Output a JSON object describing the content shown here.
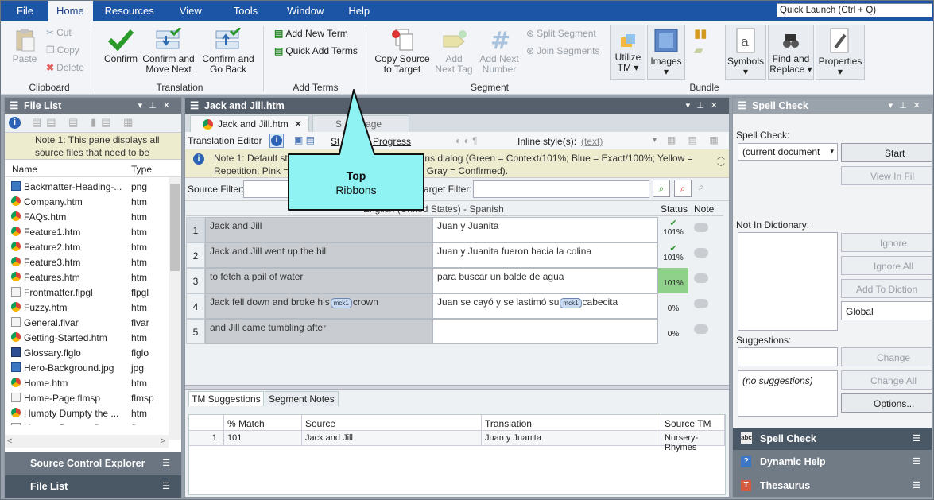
{
  "menu": {
    "file": "File",
    "home": "Home",
    "resources": "Resources",
    "view": "View",
    "tools": "Tools",
    "window": "Window",
    "help": "Help",
    "quick_launch": "Quick Launch (Ctrl + Q)"
  },
  "ribbon": {
    "clipboard": {
      "paste": "Paste",
      "cut": "Cut",
      "copy": "Copy",
      "delete": "Delete",
      "group": "Clipboard"
    },
    "translation": {
      "confirm": "Confirm",
      "confirm_move_1": "Confirm and",
      "confirm_move_2": "Move Next",
      "confirm_go_1": "Confirm and",
      "confirm_go_2": "Go Back",
      "group": "Translation"
    },
    "terms": {
      "add_new": "Add New Term",
      "quick_add": "Quick Add Terms",
      "group": "Add Terms"
    },
    "segment": {
      "copy_source_1": "Copy Source",
      "copy_source_2": "to Target",
      "add_next_tag_1": "Add",
      "add_next_tag_2": "Next Tag",
      "add_next_num_1": "Add Next",
      "add_next_num_2": "Number",
      "split": "Split Segment",
      "join": "Join Segments",
      "group": "Segment"
    },
    "bundle": {
      "utilize_1": "Utilize",
      "utilize_2": "TM ▾",
      "images_1": "Images",
      "images_2": "▾",
      "group": "Bundle"
    },
    "other": {
      "symbols_1": "Symbols",
      "symbols_2": "▾",
      "find_1": "Find and",
      "find_2": "Replace ▾",
      "props_1": "Properties",
      "props_2": "▾"
    }
  },
  "file_list": {
    "title": "File List",
    "note": "Note 1: This pane displays all source files that need to be",
    "col_name": "Name",
    "col_type": "Type",
    "files": [
      {
        "name": "Backmatter-Heading-...",
        "type": "png",
        "icon": "image-icon"
      },
      {
        "name": "Company.htm",
        "type": "htm",
        "icon": "chrome-icon"
      },
      {
        "name": "FAQs.htm",
        "type": "htm",
        "icon": "chrome-icon"
      },
      {
        "name": "Feature1.htm",
        "type": "htm",
        "icon": "chrome-icon"
      },
      {
        "name": "Feature2.htm",
        "type": "htm",
        "icon": "chrome-icon"
      },
      {
        "name": "Feature3.htm",
        "type": "htm",
        "icon": "chrome-icon"
      },
      {
        "name": "Features.htm",
        "type": "htm",
        "icon": "chrome-icon"
      },
      {
        "name": "Frontmatter.flpgl",
        "type": "flpgl",
        "icon": "doc-icon"
      },
      {
        "name": "Fuzzy.htm",
        "type": "htm",
        "icon": "chrome-icon"
      },
      {
        "name": "General.flvar",
        "type": "flvar",
        "icon": "doc-icon"
      },
      {
        "name": "Getting-Started.htm",
        "type": "htm",
        "icon": "chrome-icon"
      },
      {
        "name": "Glossary.flglo",
        "type": "flglo",
        "icon": "book-icon"
      },
      {
        "name": "Hero-Background.jpg",
        "type": "jpg",
        "icon": "image-icon"
      },
      {
        "name": "Home.htm",
        "type": "htm",
        "icon": "chrome-icon"
      },
      {
        "name": "Home-Page.flmsp",
        "type": "flmsp",
        "icon": "doc-icon"
      },
      {
        "name": "Humpty Dumpty the ...",
        "type": "htm",
        "icon": "chrome-icon"
      },
      {
        "name": "Humpty Dumpty.fltoc",
        "type": "fltoc",
        "icon": "doc-icon"
      }
    ],
    "source_control": "Source Control Explorer",
    "bottom_tab": "File List"
  },
  "editor": {
    "title": "Jack and Jill.htm",
    "tab1": "Jack and Jill.htm",
    "tab2_a": "S",
    "tab2_b": "age",
    "toolbar_label": "Translation Editor",
    "st": "St",
    "progress": "Progress",
    "inline_style": "Inline style(s):",
    "text_btn": "(text)",
    "note_1": "Note 1: Default st",
    "note_1b": "tions dialog (Green = Context/101%; Blue = Exact/100%; Yellow =",
    "note_2": "Repetition; Pink =",
    "note_2b": "d; Gray = Confirmed).",
    "source_filter": "Source Filter:",
    "target_filter": "arget Filter:",
    "grid_header": "English (United States) - Spanish",
    "col_status": "Status",
    "col_note": "Note",
    "rows": [
      {
        "num": "1",
        "src": "Jack and Jill",
        "tgt": "Juan y Juanita",
        "pct": "101%",
        "check": "✔"
      },
      {
        "num": "2",
        "src": "Jack and Jill went up the hill",
        "tgt": "Juan y Juanita fueron hacia la colina",
        "pct": "101%",
        "check": "✔"
      },
      {
        "num": "3",
        "src": "to fetch a pail of water",
        "tgt": "para buscar un balde de agua",
        "pct": "101%",
        "check": ""
      },
      {
        "num": "4",
        "src_a": "Jack fell down and broke his",
        "src_tag": "mck1",
        "src_b": "crown",
        "tgt_a": "Juan se cayó y se lastimó su",
        "tgt_tag": "mck1",
        "tgt_b": "cabecita",
        "pct": "0%"
      },
      {
        "num": "5",
        "src": "and Jill came tumbling after",
        "tgt": "",
        "pct": "0%"
      }
    ]
  },
  "tm": {
    "tab1": "TM Suggestions",
    "tab2": "Segment Notes",
    "cols": [
      "% Match",
      "Source",
      "Translation",
      "Source TM"
    ],
    "row": {
      "num": "1",
      "match": "101",
      "source": "Jack and Jill",
      "translation": "Juan y Juanita",
      "tm": "Nursery-Rhymes"
    }
  },
  "spell": {
    "title": "Spell Check",
    "label": "Spell Check:",
    "doc": "(current document",
    "start": "Start",
    "view_in": "View In Fil",
    "not_in_dict": "Not In Dictionary:",
    "ignore": "Ignore",
    "ignore_all": "Ignore All",
    "add_to": "Add To Diction",
    "global": "Global",
    "suggestions": "Suggestions:",
    "no_sugg": "(no suggestions)",
    "change": "Change",
    "change_all": "Change All",
    "options": "Options...",
    "tab1": "Spell Check",
    "tab2": "Dynamic Help",
    "tab3": "Thesaurus"
  },
  "callout": {
    "line1": "Top",
    "line2": "Ribbons"
  },
  "colors": {
    "menubar": "#1c55a5",
    "callout": "#8ff3f3",
    "confirm_green": "#8fd08a",
    "note_bg": "#eeeccf"
  }
}
